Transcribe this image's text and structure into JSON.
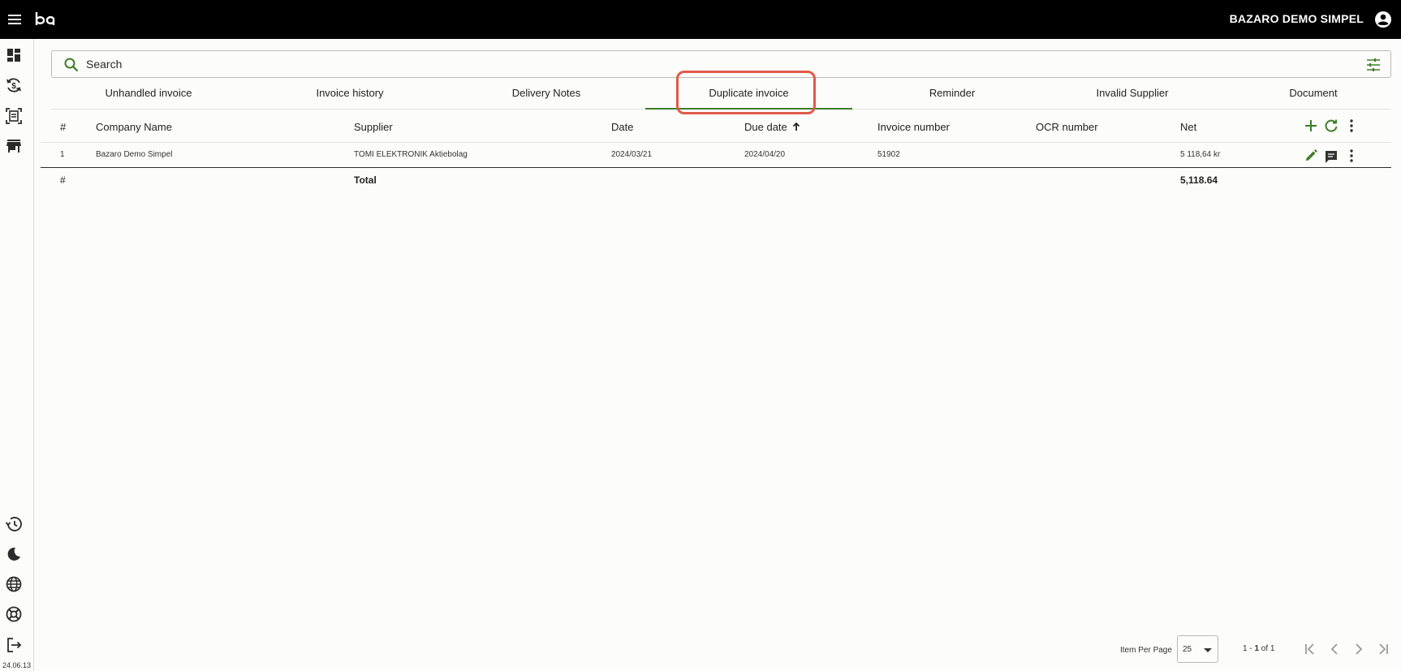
{
  "header": {
    "user_name": "BAZARO DEMO SIMPEL",
    "icons": [
      "menu-icon",
      "logo",
      "account-circle-icon"
    ]
  },
  "sidebar": {
    "icons": [
      "dashboard-icon",
      "currency-exchange-icon",
      "document-scan-icon",
      "store-icon",
      "history-icon",
      "dark-mode-icon",
      "language-icon",
      "support-icon",
      "logout-icon"
    ],
    "version": "24.06.13"
  },
  "search": {
    "placeholder": "Search"
  },
  "tabs": [
    {
      "label": "Unhandled invoice"
    },
    {
      "label": "Invoice history"
    },
    {
      "label": "Delivery Notes"
    },
    {
      "label": "Duplicate invoice",
      "active": true
    },
    {
      "label": "Reminder"
    },
    {
      "label": "Invalid Supplier"
    },
    {
      "label": "Document"
    }
  ],
  "table": {
    "columns": {
      "num": "#",
      "company": "Company Name",
      "supplier": "Supplier",
      "date": "Date",
      "due_date": "Due date",
      "invoice_number": "Invoice number",
      "ocr_number": "OCR number",
      "net": "Net"
    },
    "sort_icon": "arrow-up-icon",
    "rows": [
      {
        "num": "1",
        "company": "Bazaro Demo Simpel",
        "supplier": "TOMI ELEKTRONIK Aktiebolag",
        "date": "2024/03/21",
        "due_date": "2024/04/20",
        "invoice_number": "51902",
        "ocr_number": "",
        "net": "5 118,64 kr"
      }
    ],
    "total": {
      "num": "#",
      "label": "Total",
      "net": "5,118.64"
    }
  },
  "colors": {
    "accent": "#3e7d2a",
    "highlight": "#e05a4a"
  },
  "pagination": {
    "items_per_page_label": "Item Per Page",
    "items_per_page": "25",
    "range_start": "1 - ",
    "range_end": "1",
    "range_of": " of 1"
  }
}
